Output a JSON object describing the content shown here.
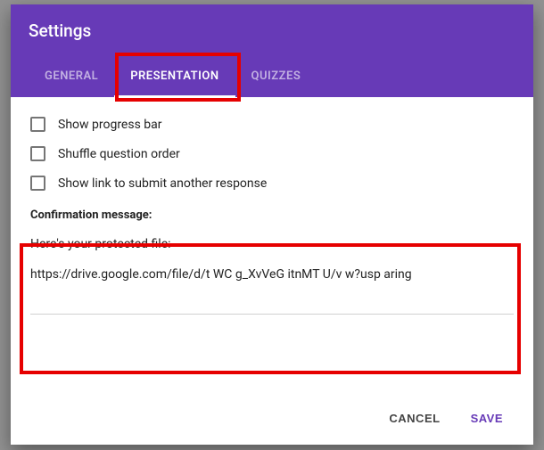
{
  "header": {
    "title": "Settings"
  },
  "tabs": {
    "general": "General",
    "presentation": "Presentation",
    "quizzes": "Quizzes"
  },
  "options": {
    "progress": "Show progress bar",
    "shuffle": "Shuffle question order",
    "submit_another": "Show link to submit another response"
  },
  "confirm": {
    "label": "Confirmation message:",
    "line1": "Here's your protected file:",
    "line2": "https://drive.google.com/file/d/t    WC    g_XvVeG       itnMT       U/v    w?usp    aring"
  },
  "footer": {
    "cancel": "Cancel",
    "save": "Save"
  }
}
